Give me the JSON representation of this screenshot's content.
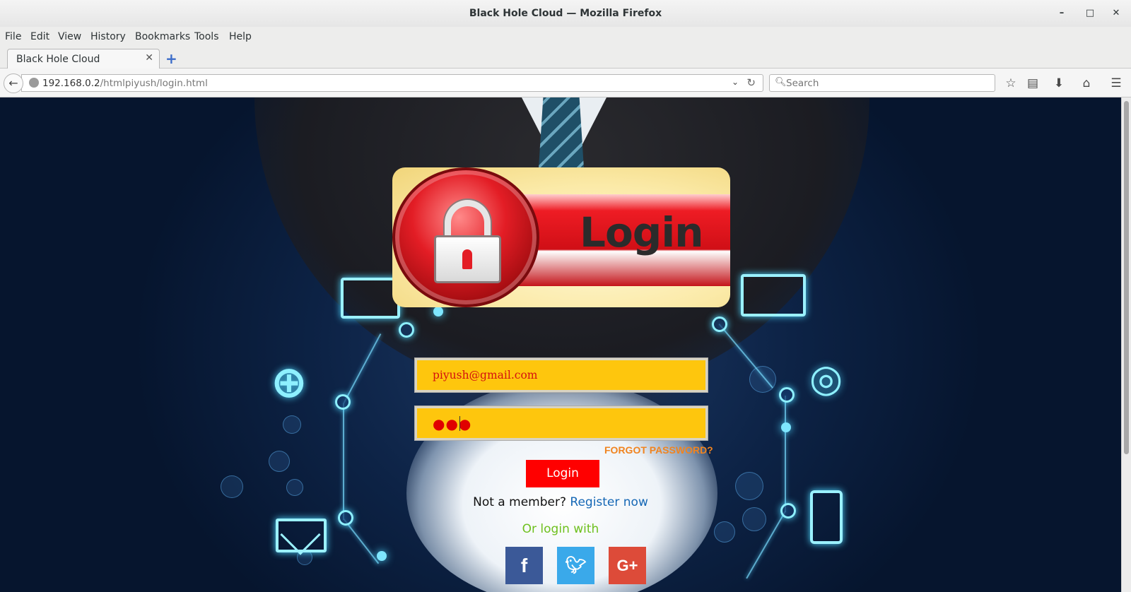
{
  "window": {
    "title": "Black Hole Cloud — Mozilla Firefox",
    "minimize": "–",
    "maximize": "□",
    "close": "✕"
  },
  "menu": [
    "File",
    "Edit",
    "View",
    "History",
    "Bookmarks",
    "Tools",
    "Help"
  ],
  "tabs": [
    {
      "title": "Black Hole Cloud",
      "close": "✕"
    }
  ],
  "new_tab": "+",
  "navbar": {
    "url_host": "192.168.0.2",
    "url_path": "/htmlpiyush/login.html",
    "search_placeholder": "Search",
    "icons": [
      "bookmark-star-icon",
      "reading-list-icon",
      "download-icon",
      "home-icon",
      "menu-icon"
    ]
  },
  "banner": {
    "text": "Login"
  },
  "form": {
    "email_value": "piyush@gmail.com",
    "password_mask": "●●●",
    "forgot_label": "FORGOT PASSWORD?",
    "login_label": "Login",
    "member_text": "Not a member?",
    "register_label": "Register now",
    "or_login_with": "Or login with"
  },
  "social": {
    "facebook": "f",
    "twitter": "🐦",
    "google": "G+"
  },
  "colors": {
    "field_bg": "#fec60d",
    "login_btn": "#ff0000",
    "forgot": "#f08420",
    "register": "#1567b5",
    "or_login": "#6ec01e",
    "facebook": "#3b5998",
    "twitter": "#3aa9ea",
    "google": "#dd4b39"
  }
}
